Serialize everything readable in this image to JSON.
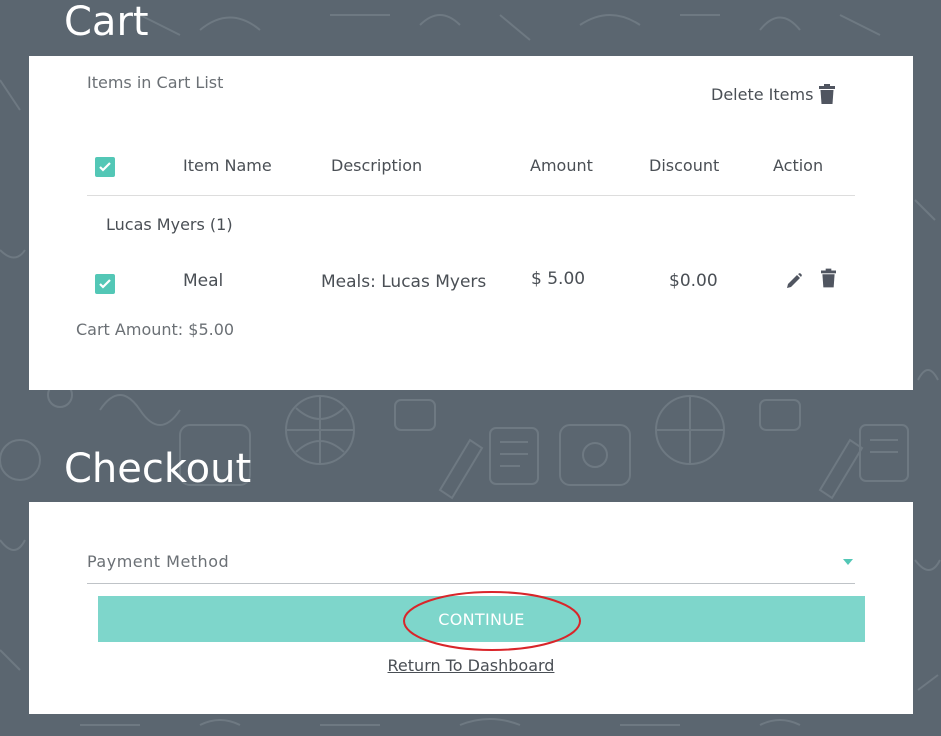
{
  "cart": {
    "title": "Cart",
    "list_heading": "Items in Cart List",
    "delete_items_label": "Delete Items",
    "columns": [
      "Item Name",
      "Description",
      "Amount",
      "Discount",
      "Action"
    ],
    "groups": [
      {
        "name": "Lucas Myers (1)",
        "items": [
          {
            "item_name": "Meal",
            "description": "Meals: Lucas Myers",
            "amount": "$ 5.00",
            "discount": "$0.00",
            "checked": true
          }
        ]
      }
    ],
    "cart_amount": "Cart Amount: $5.00"
  },
  "checkout": {
    "title": "Checkout",
    "payment_placeholder": "Payment Method",
    "continue_label": "CONTINUE",
    "return_link": "Return To Dashboard"
  },
  "colors": {
    "background": "#5b6670",
    "accent": "#53c7b6",
    "button": "#7ed6cb",
    "annotation": "#d9252a"
  },
  "icons": [
    "trash-icon",
    "edit-pencil-icon",
    "check-icon",
    "dropdown-caret-icon"
  ]
}
